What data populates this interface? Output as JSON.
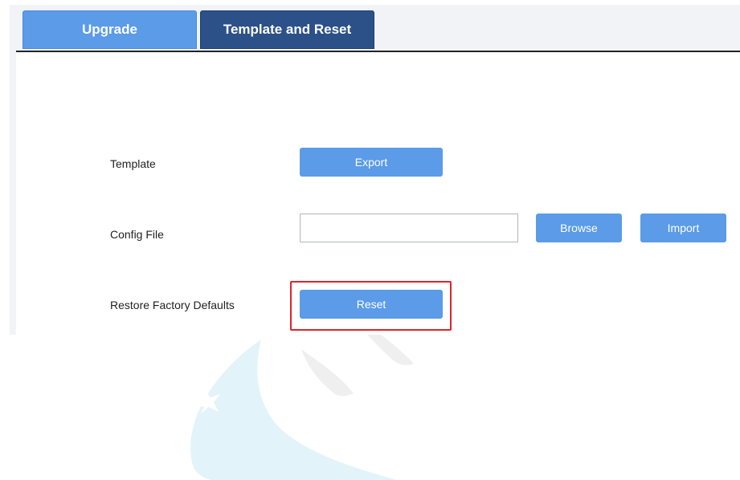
{
  "tabs": [
    {
      "label": "Upgrade",
      "active": false
    },
    {
      "label": "Template and Reset",
      "active": true
    }
  ],
  "template_row": {
    "label": "Template",
    "export_label": "Export"
  },
  "config_row": {
    "label": "Config File",
    "file_value": "",
    "browse_label": "Browse",
    "import_label": "Import"
  },
  "restore_row": {
    "label": "Restore Factory Defaults",
    "reset_label": "Reset"
  },
  "colors": {
    "button": "#5b9be8",
    "active_tab": "#2c5088",
    "highlight": "#e0242a"
  }
}
